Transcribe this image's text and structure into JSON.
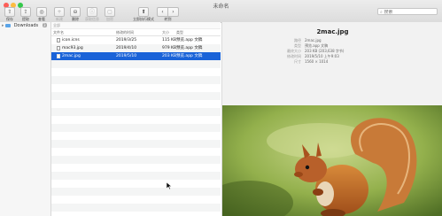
{
  "window": {
    "title": "未命名"
  },
  "toolbar": {
    "buttons": [
      {
        "label": "保存",
        "icon": "save-icon",
        "glyph": "⇧",
        "enabled": true
      },
      {
        "label": "提取",
        "icon": "extract-icon",
        "glyph": "⇪",
        "enabled": true
      },
      {
        "label": "查看",
        "icon": "view-icon",
        "glyph": "◎",
        "enabled": true
      },
      {
        "label": "新建",
        "icon": "new-folder-icon",
        "glyph": "+",
        "enabled": false
      },
      {
        "label": "删除",
        "icon": "delete-icon",
        "glyph": "⊖",
        "enabled": true
      },
      {
        "label": "获取信息",
        "icon": "info-icon",
        "glyph": "ⓘ",
        "enabled": false
      },
      {
        "label": "加密",
        "icon": "lock-icon",
        "glyph": "▢",
        "enabled": false
      }
    ],
    "mode_label": "立即执行模式",
    "mode_glyph": "⬆",
    "nav_label": "转到",
    "back_glyph": "‹",
    "forward_glyph": "›",
    "search_placeholder": "搜索",
    "search_glyph": "⌕"
  },
  "sidebar": {
    "items": [
      {
        "label": "Downloads",
        "count": "3",
        "expander": "▸"
      }
    ]
  },
  "filelist": {
    "group": "全部",
    "columns": {
      "name": "文件名",
      "modified": "修改的时间",
      "size": "大小",
      "kind": "类型"
    },
    "rows": [
      {
        "name": "icon.icns",
        "modified": "2019/3/25",
        "size": "115 KB",
        "kind": "预览.app 文稿",
        "selected": false
      },
      {
        "name": "mac93.jpg",
        "modified": "2019/4/10",
        "size": "979 KB",
        "kind": "预览.app 文稿",
        "selected": false
      },
      {
        "name": "2mac.jpg",
        "modified": "2019/5/10",
        "size": "203 KB",
        "kind": "预览.app 文稿",
        "selected": true
      }
    ]
  },
  "preview": {
    "filename": "2mac.jpg",
    "meta": [
      {
        "key": "路径",
        "value": "2mac.jpg"
      },
      {
        "key": "类型",
        "value": "预览.app 文稿"
      },
      {
        "key": "最终大小",
        "value": "203 KB (203,638 字节)"
      },
      {
        "key": "修改时间",
        "value": "2019/5/10 上午9:03"
      },
      {
        "key": "尺寸",
        "value": "1560 × 1014"
      }
    ]
  },
  "colors": {
    "selection": "#1a63d8",
    "close": "#fc5d57",
    "minimize": "#fdbc40",
    "maximize": "#34c84a"
  }
}
